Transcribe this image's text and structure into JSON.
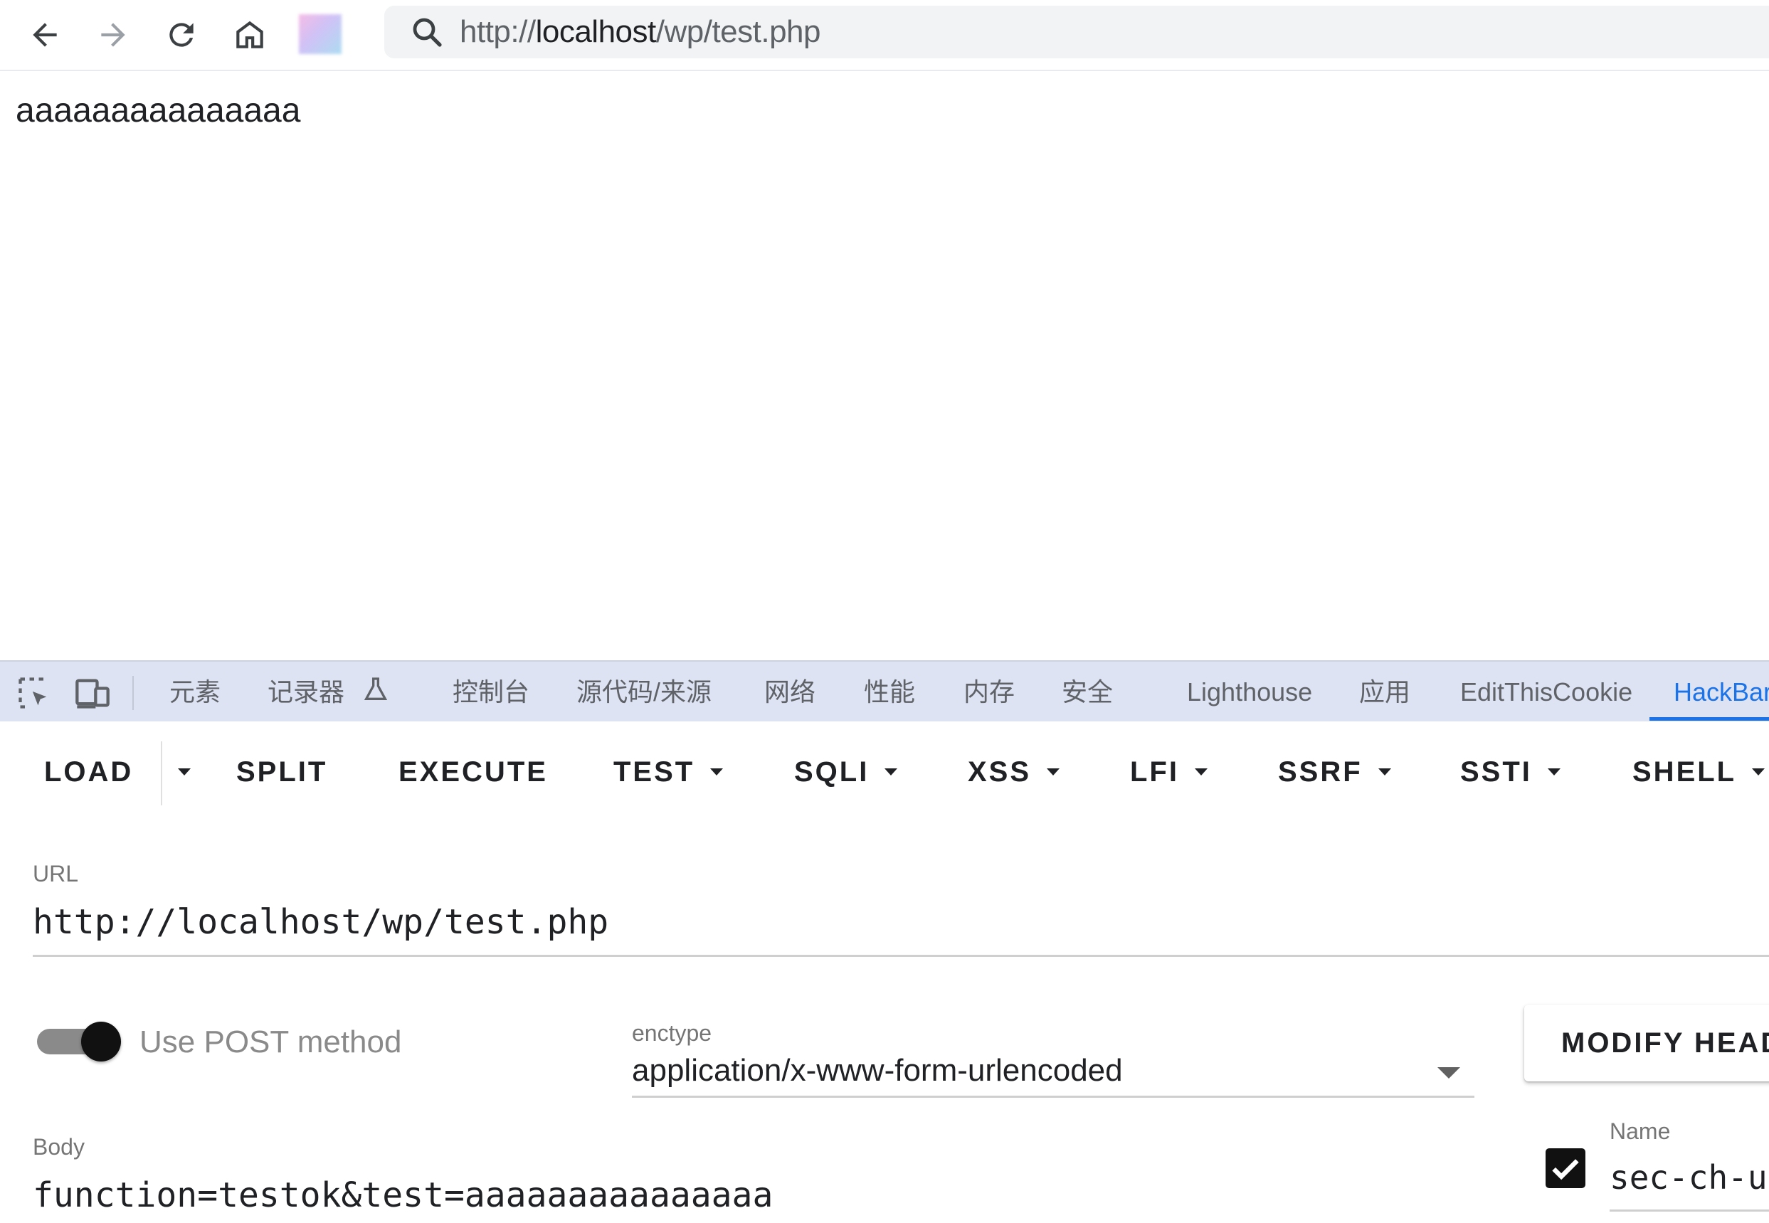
{
  "browser": {
    "url_scheme": "http://",
    "url_host": "localhost",
    "url_path": "/wp/test.php"
  },
  "page": {
    "content_text": "aaaaaaaaaaaaaaa"
  },
  "devtools": {
    "tabs": [
      {
        "label": "元素"
      },
      {
        "label": "记录器"
      },
      {
        "label": "控制台"
      },
      {
        "label": "源代码/来源"
      },
      {
        "label": "网络"
      },
      {
        "label": "性能"
      },
      {
        "label": "内存"
      },
      {
        "label": "安全"
      },
      {
        "label": "Lighthouse"
      },
      {
        "label": "应用"
      },
      {
        "label": "EditThisCookie"
      },
      {
        "label": "HackBar"
      }
    ],
    "active_tab": "HackBar",
    "accent_color": "#1a73e8"
  },
  "hackbar": {
    "menu": {
      "load": "LOAD",
      "split": "SPLIT",
      "execute": "EXECUTE",
      "test": "TEST",
      "sqli": "SQLI",
      "xss": "XSS",
      "lfi": "LFI",
      "ssrf": "SSRF",
      "ssti": "SSTI",
      "shell": "SHELL"
    },
    "url_label": "URL",
    "url_value": "http://localhost/wp/test.php",
    "post_toggle_label": "Use POST method",
    "post_enabled": true,
    "enctype_label": "enctype",
    "enctype_value": "application/x-www-form-urlencoded",
    "modify_headers_label": "MODIFY HEAD",
    "body_label": "Body",
    "body_value": "function=testok&test=aaaaaaaaaaaaaaa",
    "header_name_label": "Name",
    "header_name_value": "sec-ch-u",
    "header_checked": true
  }
}
